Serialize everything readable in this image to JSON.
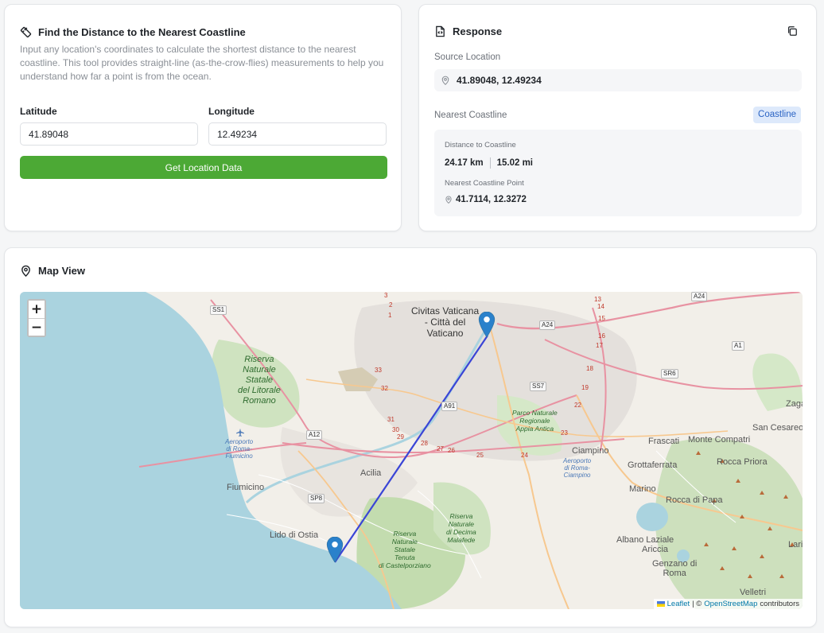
{
  "input": {
    "title": "Find the Distance to the Nearest Coastline",
    "description": "Input any location's coordinates to calculate the shortest distance to the nearest coastline. This tool provides straight-line (as-the-crow-flies) measurements to help you understand how far a point is from the ocean.",
    "latitude_label": "Latitude",
    "latitude_value": "41.89048",
    "longitude_label": "Longitude",
    "longitude_value": "12.49234",
    "button_label": "Get Location Data"
  },
  "response": {
    "title": "Response",
    "source_label": "Source Location",
    "source_value": "41.89048, 12.49234",
    "nearest_label": "Nearest Coastline",
    "badge": "Coastline",
    "distance_label": "Distance to Coastline",
    "distance_km": "24.17 km",
    "distance_mi": "15.02 mi",
    "point_label": "Nearest Coastline Point",
    "point_value": "41.7114, 12.3272"
  },
  "map": {
    "title": "Map View",
    "zoom_in": "+",
    "zoom_out": "−",
    "attribution_leaflet": "Leaflet",
    "attribution_sep": "| ©",
    "attribution_osm": "OpenStreetMap",
    "attribution_suffix": "contributors",
    "labels": {
      "vatican": "Civitas Vaticana\n- Città del\nVaticano",
      "reserve_litorale": "Riserva\nNaturale\nStatale\ndel Litorale\nRomano",
      "aeroporto_fiumicino": "Aeroporto\ndi Roma-\nFiumicino",
      "fiumicino": "Fiumicino",
      "acilia": "Acilia",
      "lido_ostia": "Lido di Ostia",
      "reserve_castel": "Riserva\nNaturale\nStatale\nTenuta\ndi Castelporziano",
      "reserve_decima": "Riserva\nNaturale\ndi Decima\nMalafede",
      "parco_appia": "Parco Naturale\nRegionale\nAppia Antica",
      "aeroporto_ciampino": "Aeroporto\ndi Roma-\nCiampino",
      "ciampino": "Ciampino",
      "frascati": "Frascati",
      "monte_compatri": "Monte Compatri",
      "san_cesareo": "San Cesareo",
      "zaga": "Zaga",
      "grottaferrata": "Grottaferrata",
      "rocca_priora": "Rocca Priora",
      "marino": "Marino",
      "rocca_di_papa": "Rocca di Papa",
      "albano": "Albano Laziale",
      "ariccia": "Ariccia",
      "genzano": "Genzano di\nRoma",
      "lari": "Lari",
      "velletri": "Velletri"
    },
    "roads": [
      "SS1",
      "A24",
      "A24",
      "A1",
      "SR6",
      "SS7",
      "A91",
      "A12",
      "SP8"
    ],
    "road_numbers": [
      "13",
      "14",
      "15",
      "16",
      "17",
      "18",
      "19",
      "22",
      "23",
      "24",
      "25",
      "26",
      "27",
      "28",
      "29",
      "30",
      "31",
      "32",
      "33",
      "3",
      "2",
      "1"
    ]
  }
}
